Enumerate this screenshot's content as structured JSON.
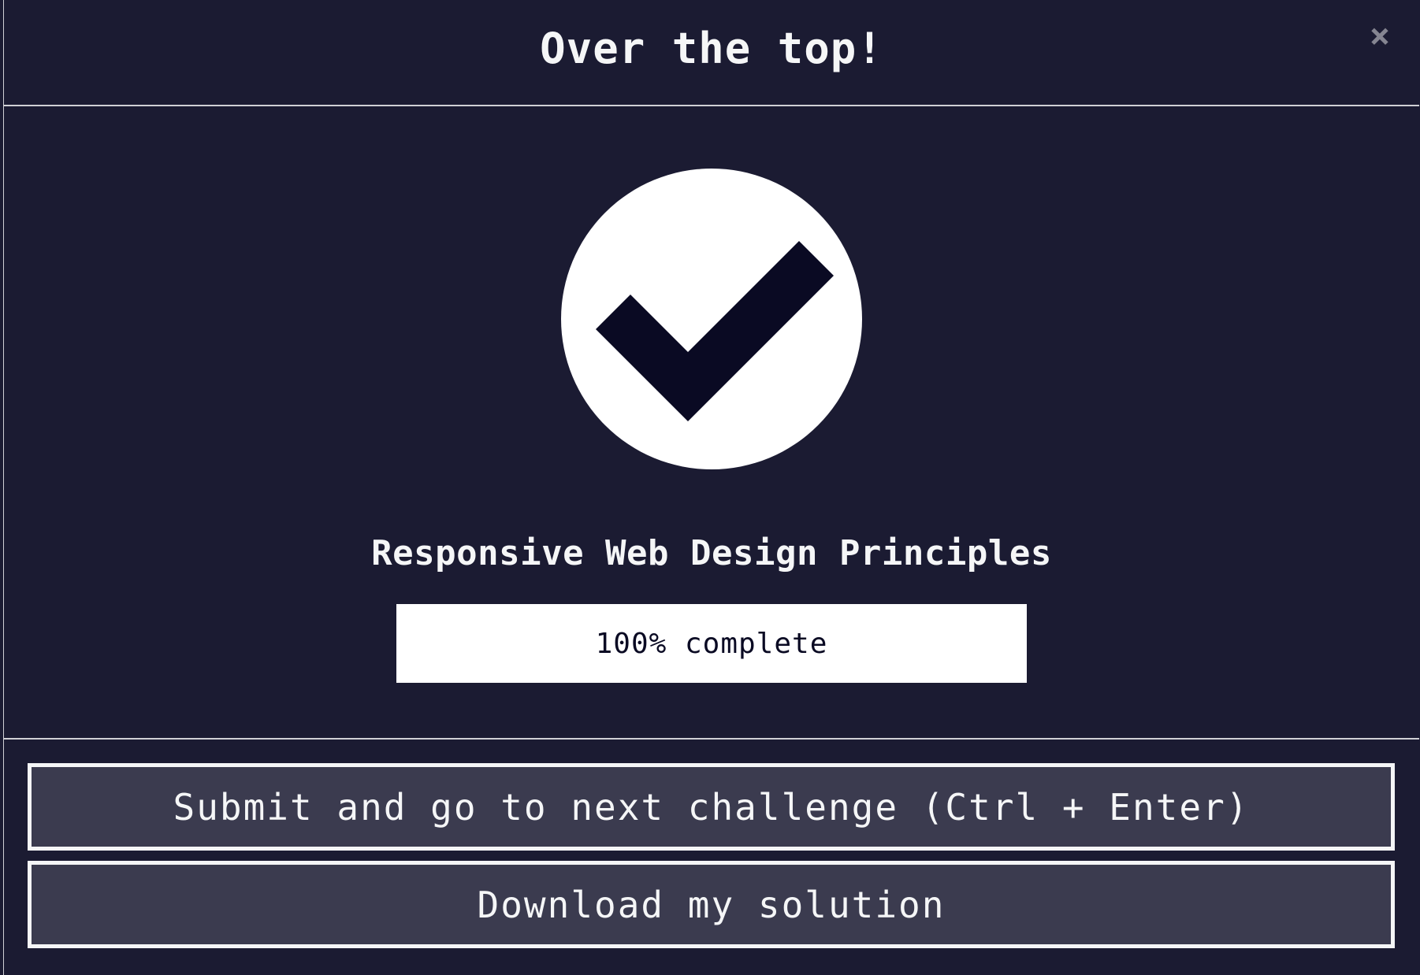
{
  "modal": {
    "title": "Over the top!",
    "close_label": "×"
  },
  "completion": {
    "block_title": "Responsive Web Design Principles",
    "progress_text": "100% complete",
    "progress_fraction": 1.0
  },
  "buttons": {
    "submit_label": "Submit and go to next challenge (Ctrl + Enter)",
    "download_label": "Download my solution"
  },
  "colors": {
    "background": "#1b1b32",
    "button_background": "#3b3b4f",
    "foreground": "#f5f6f7",
    "check_mark": "#0a0a23"
  },
  "icons": {
    "success": "check-circle-icon",
    "close": "close-icon"
  }
}
